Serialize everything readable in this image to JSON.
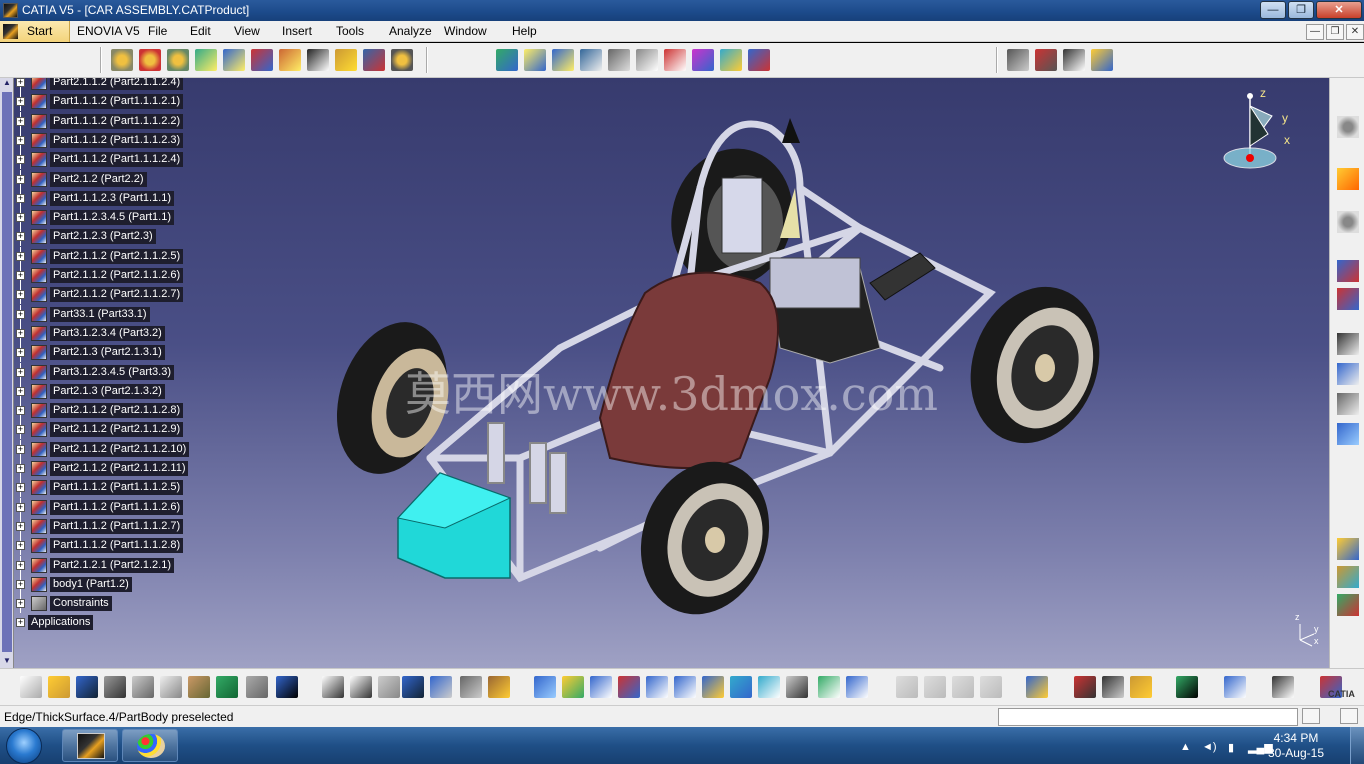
{
  "window": {
    "title": "CATIA V5 - [CAR ASSEMBLY.CATProduct]",
    "minimize_label": "—",
    "restore_label": "❐",
    "close_label": "✕"
  },
  "menu": {
    "items": [
      "Start",
      "ENOVIA V5",
      "File",
      "Edit",
      "View",
      "Insert",
      "Tools",
      "Analyze",
      "Window",
      "Help"
    ],
    "mdi_min": "—",
    "mdi_restore": "❐",
    "mdi_close": "✕"
  },
  "tree": {
    "items": [
      "Part2.1.1.2 (Part2.1.1.2.4)",
      "Part1.1.1.2 (Part1.1.1.2.1)",
      "Part1.1.1.2 (Part1.1.1.2.2)",
      "Part1.1.1.2 (Part1.1.1.2.3)",
      "Part1.1.1.2 (Part1.1.1.2.4)",
      "Part2.1.2 (Part2.2)",
      "Part1.1.1.2.3 (Part1.1.1)",
      "Part1.1.2.3.4.5 (Part1.1)",
      "Part2.1.2.3 (Part2.3)",
      "Part2.1.1.2 (Part2.1.1.2.5)",
      "Part2.1.1.2 (Part2.1.1.2.6)",
      "Part2.1.1.2 (Part2.1.1.2.7)",
      "Part33.1 (Part33.1)",
      "Part3.1.2.3.4 (Part3.2)",
      "Part2.1.3 (Part2.1.3.1)",
      "Part3.1.2.3.4.5 (Part3.3)",
      "Part2.1.3 (Part2.1.3.2)",
      "Part2.1.1.2 (Part2.1.1.2.8)",
      "Part2.1.1.2 (Part2.1.1.2.9)",
      "Part2.1.1.2 (Part2.1.1.2.10)",
      "Part2.1.1.2 (Part2.1.1.2.11)",
      "Part1.1.1.2 (Part1.1.1.2.5)",
      "Part1.1.1.2 (Part1.1.1.2.6)",
      "Part1.1.1.2 (Part1.1.1.2.7)",
      "Part1.1.1.2 (Part1.1.1.2.8)",
      "Part2.1.2.1 (Part2.1.2.1)",
      "body1 (Part1.2)",
      "Constraints"
    ],
    "applications": "Applications"
  },
  "compass": {
    "z": "z",
    "y": "y",
    "x": "x"
  },
  "watermark": "莫西网www.3dmox.com",
  "axis_small": {
    "z": "z",
    "y": "y",
    "x": "x"
  },
  "status": {
    "text": "Edge/ThickSurface.4/PartBody preselected",
    "command_value": ""
  },
  "taskbar": {
    "time": "4:34 PM",
    "date": "30-Aug-15"
  },
  "brand": {
    "catia_label": "CATIA"
  }
}
